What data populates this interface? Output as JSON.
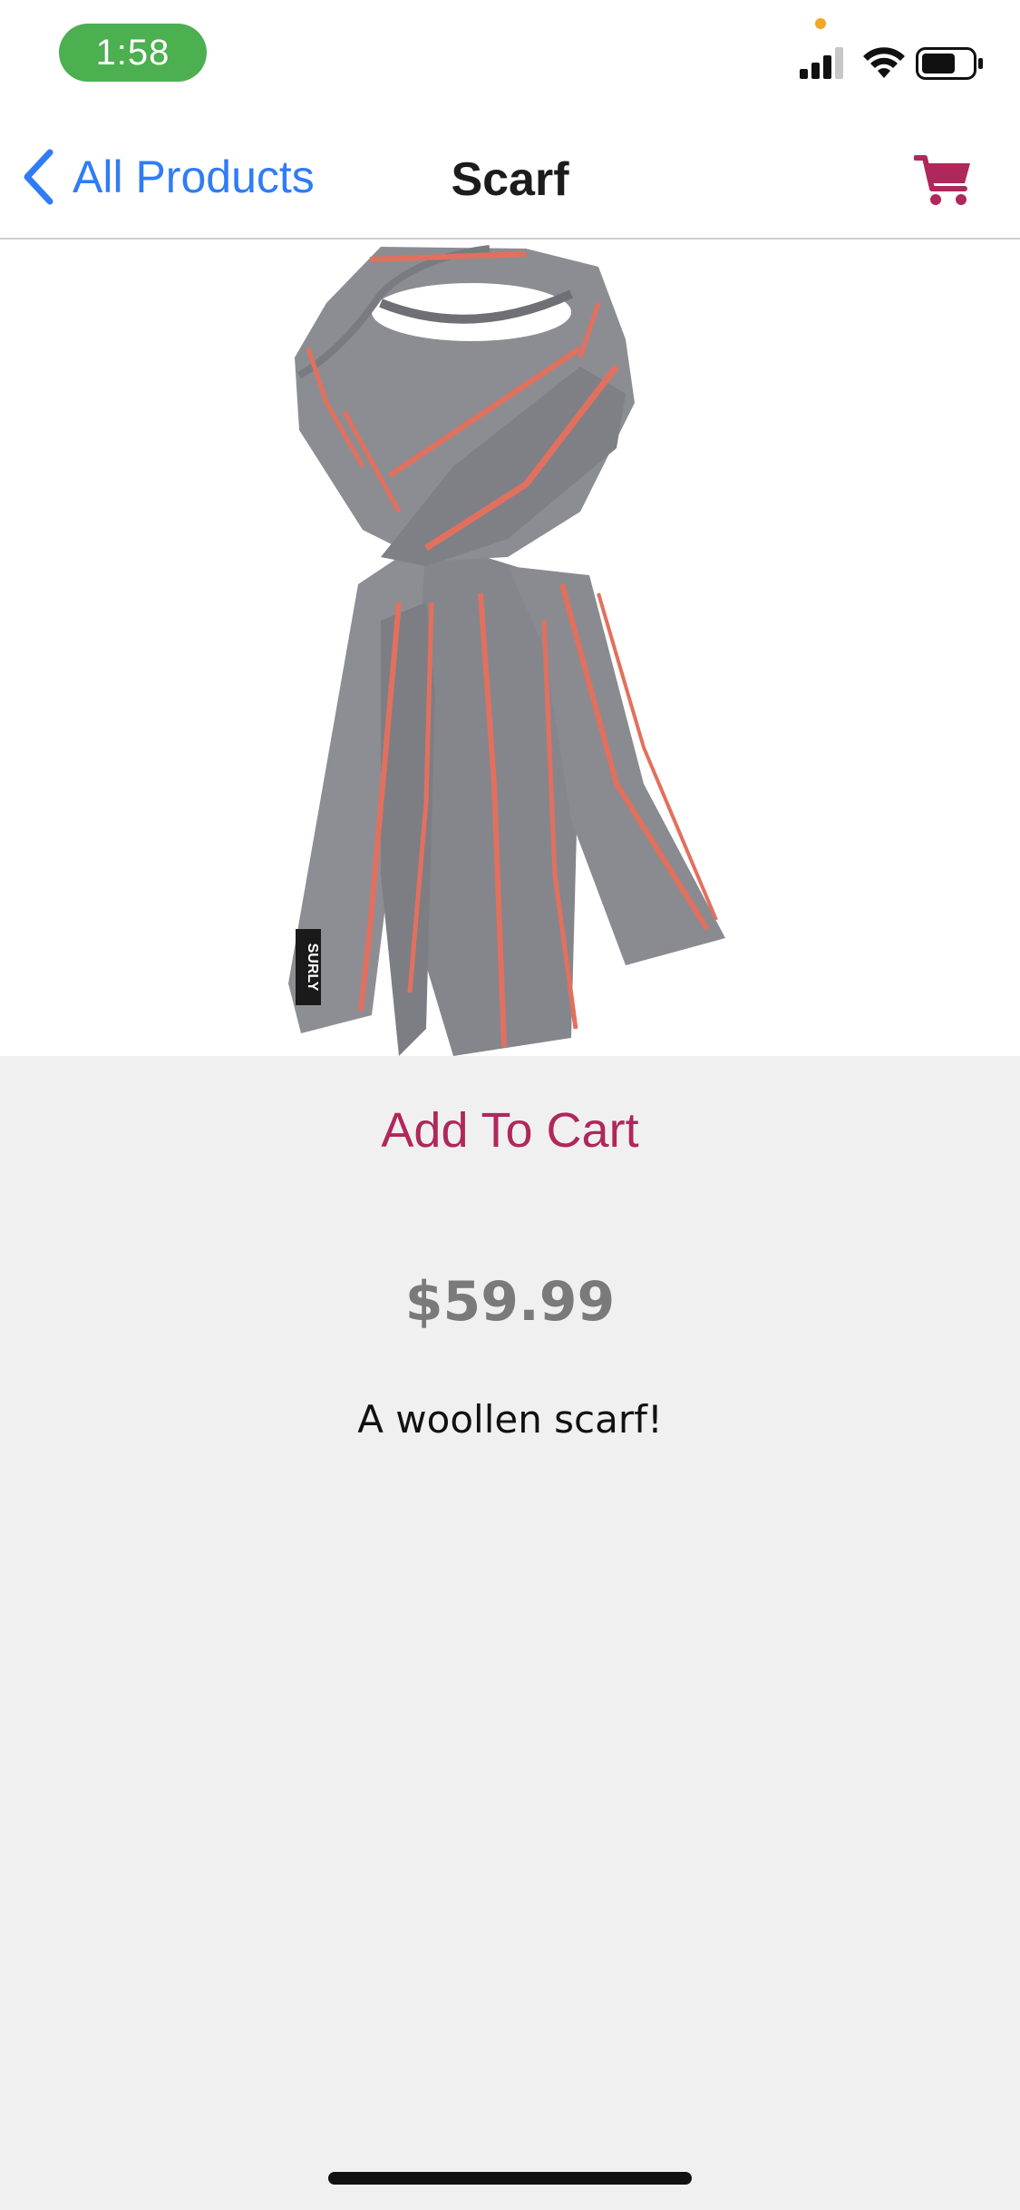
{
  "status_bar": {
    "time": "1:58",
    "icons": [
      "cellular-signal-icon",
      "wifi-icon",
      "battery-icon"
    ],
    "privacy_indicator_color": "#f5a623",
    "time_pill_color": "#4caf50"
  },
  "nav": {
    "back_label": "All Products",
    "title": "Scarf",
    "cart_icon": "shopping-cart-icon"
  },
  "product": {
    "image_icon": "scarf-image",
    "tag_text": "SURLY",
    "add_to_cart_label": "Add To Cart",
    "price": "$59.99",
    "description": "A woollen scarf!"
  },
  "colors": {
    "accent_blue": "#2f7cf6",
    "accent_magenta": "#b0275b",
    "background": "#f0f0f0",
    "price_gray": "#7a7a7a",
    "scarf_gray": "#8a8b8f",
    "scarf_stripe": "#e2705e"
  }
}
